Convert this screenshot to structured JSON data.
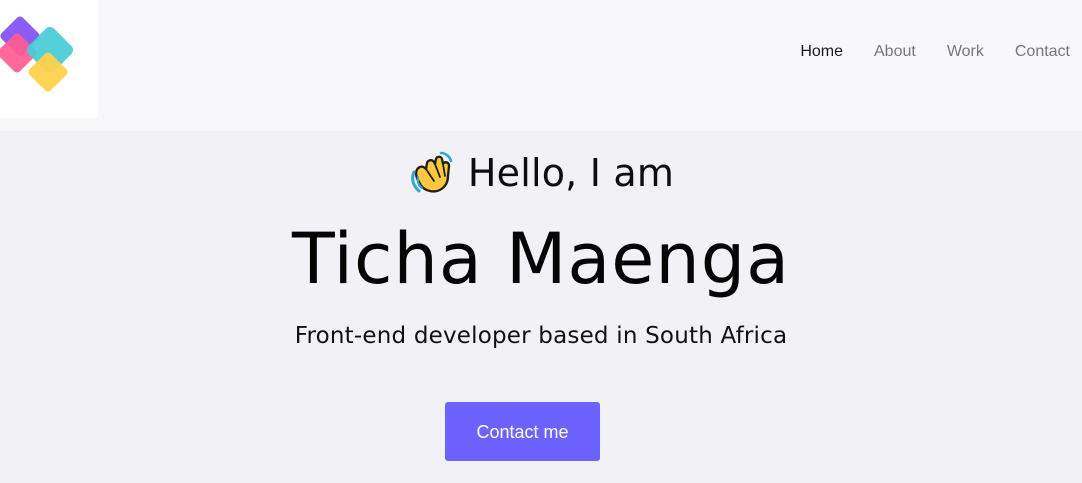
{
  "header": {
    "logo": {
      "icon": "diamond-logo-icon",
      "colors": [
        "#8b5cf6",
        "#ff5c93",
        "#47ccd6",
        "#ffd24d"
      ]
    },
    "nav": {
      "items": [
        {
          "label": "Home",
          "active": true
        },
        {
          "label": "About",
          "active": false
        },
        {
          "label": "Work",
          "active": false
        },
        {
          "label": "Contact",
          "active": false
        }
      ]
    }
  },
  "hero": {
    "greeting_icon": "waving-hand-icon",
    "greeting": "Hello, I am",
    "name": "Ticha Maenga",
    "subtitle": "Front-end developer based in South Africa",
    "cta_label": "Contact me"
  },
  "colors": {
    "accent": "#6c63ff",
    "background": "#f1f1f6",
    "header_background": "#f8f8fb",
    "active_nav": "#1a1a1a",
    "inactive_nav": "#777777"
  }
}
